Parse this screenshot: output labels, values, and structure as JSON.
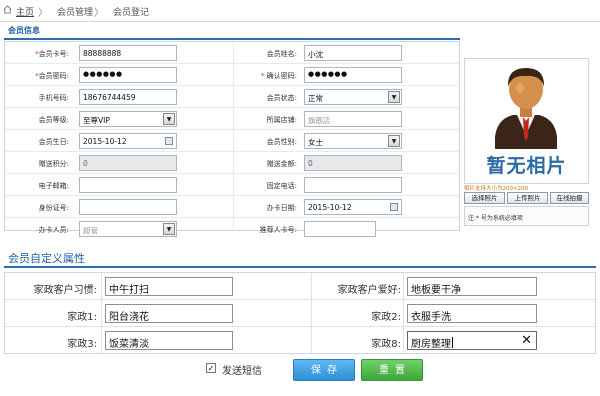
{
  "breadcrumb": {
    "home": "主页",
    "sep": "〉",
    "level1": "会员管理",
    "level2": "会员登记"
  },
  "section_basic": {
    "title": "会员信息"
  },
  "form": {
    "rows": [
      {
        "left": {
          "required": true,
          "label": "会员卡号:",
          "value": "88888888"
        },
        "right": {
          "required": false,
          "label": "会员姓名:",
          "value": "小沈"
        }
      },
      {
        "left": {
          "required": true,
          "label": "会员密码:",
          "value": "●●●●●●"
        },
        "right": {
          "required": true,
          "label": "确认密码:",
          "value": "●●●●●●"
        }
      },
      {
        "left": {
          "label": "手机号码:",
          "value": "18676744459"
        },
        "right": {
          "label": "会员状态:",
          "value": "正常"
        }
      },
      {
        "left": {
          "label": "会员等级:",
          "value": "至尊VIP"
        },
        "right": {
          "label": "所属店铺:",
          "value": "旗舰店"
        }
      },
      {
        "left": {
          "label": "会员生日:",
          "value": "2015-10-12"
        },
        "right": {
          "label": "会员性别:",
          "value": "女士"
        }
      },
      {
        "left": {
          "label": "赠送积分:",
          "value": "0"
        },
        "right": {
          "label": "赠送金额:",
          "value": "0"
        }
      },
      {
        "left": {
          "label": "电子邮箱:",
          "value": ""
        },
        "right": {
          "label": "固定电话:",
          "value": ""
        }
      },
      {
        "left": {
          "label": "身份证号:",
          "value": ""
        },
        "right": {
          "label": "办卡日期:",
          "value": "2015-10-12"
        }
      },
      {
        "left": {
          "label": "办卡人员:",
          "value": "超管"
        },
        "right": {
          "label": "推荐人卡号:",
          "value": ""
        }
      }
    ]
  },
  "photo": {
    "placeholder_text": "暂无相片",
    "note": "相片支持大小为200×200",
    "buttons": {
      "select": "选择照片",
      "upload": "上传照片",
      "camera": "在线拍摄"
    },
    "required_note": "注:* 号为系统必填项"
  },
  "section_custom": {
    "title": "会员自定义属性"
  },
  "custom": {
    "rows": [
      {
        "left_label": "家政客户习惯:",
        "left_value": "中午打扫",
        "right_label": "家政客户爱好:",
        "right_value": "地板要干净"
      },
      {
        "left_label": "家政1:",
        "left_value": "阳台浇花",
        "right_label": "家政2:",
        "right_value": "衣服手洗"
      },
      {
        "left_label": "家政3:",
        "left_value": "饭菜清淡",
        "right_label": "家政8:",
        "right_value": "厨房整理"
      }
    ],
    "clear_icon": "close-icon"
  },
  "footer": {
    "sms_checked": true,
    "sms_label": "发送短信",
    "save_label": "保存",
    "reset_label": "重置"
  },
  "colors": {
    "accent": "#2a6db5",
    "required": "#e2261c",
    "save": "#2d8fd6",
    "reset": "#3ea63a"
  }
}
